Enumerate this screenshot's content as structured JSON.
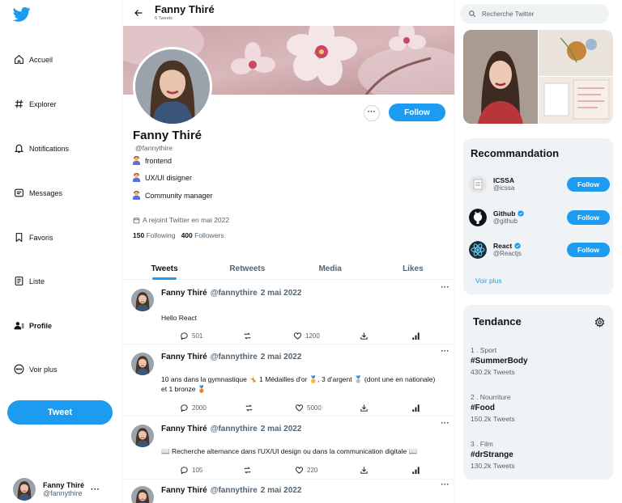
{
  "colors": {
    "accent": "#1d9bf0",
    "text": "#0f1419",
    "muted": "#536471",
    "card": "#f0f3f5"
  },
  "sidebar": {
    "logo": "twitter-bird-icon",
    "items": [
      {
        "label": "Accueil",
        "icon": "home-icon"
      },
      {
        "label": "Explorer",
        "icon": "hashtag-icon"
      },
      {
        "label": "Notifications",
        "icon": "bell-icon"
      },
      {
        "label": "Messages",
        "icon": "message-icon"
      },
      {
        "label": "Favoris",
        "icon": "bookmark-icon"
      },
      {
        "label": "Liste",
        "icon": "list-icon"
      },
      {
        "label": "Profile",
        "icon": "profile-icon"
      },
      {
        "label": "Voir plus",
        "icon": "more-circle-icon"
      }
    ],
    "tweet_button": "Tweet",
    "account": {
      "name": "Fanny Thiré",
      "handle": "@fannythire",
      "more": "···"
    }
  },
  "header": {
    "name": "Fanny Thiré",
    "tweet_count": "6 Tweets"
  },
  "profile": {
    "follow_button": "Follow",
    "more": "···",
    "name": "Fanny Thiré",
    "handle": "@fannythire",
    "bio": [
      "frontend",
      "UX/UI disigner",
      "Community manager"
    ],
    "joined": "A rejoint Twitter en mai 2022",
    "following_count": "150",
    "following_label": "Following",
    "followers_count": "400",
    "followers_label": "Followers"
  },
  "tabs": [
    "Tweets",
    "Retweets",
    "Media",
    "Likes"
  ],
  "tweets": [
    {
      "name": "Fanny Thiré",
      "handle": "@fannythire",
      "date": "2 mai 2022",
      "more": "···",
      "text": "Hello React",
      "replies": "501",
      "likes": "1200"
    },
    {
      "name": "Fanny Thiré",
      "handle": "@fannythire",
      "date": "2 mai 2022",
      "more": "···",
      "text": "10 ans dans la gymnastique 🤸 1 Médailles d'or 🥇, 3 d'argent 🥈 (dont une en nationale) et 1 bronze 🥉",
      "replies": "2000",
      "likes": "5000"
    },
    {
      "name": "Fanny Thiré",
      "handle": "@fannythire",
      "date": "2 mai 2022",
      "more": "···",
      "text": "📖 Recherche alternance dans l'UX/UI design ou dans la communication digitale 📖",
      "replies": "105",
      "likes": "220"
    },
    {
      "name": "Fanny Thiré",
      "handle": "@fannythire",
      "date": "2 mai 2022",
      "more": "···"
    }
  ],
  "search": {
    "placeholder": "Recherche Twitter"
  },
  "recommandation": {
    "title": "Recommandation",
    "accounts": [
      {
        "name": "ICSSA",
        "handle": "@icssa",
        "verified": false,
        "follow": "Follow"
      },
      {
        "name": "Github",
        "handle": "@github",
        "verified": true,
        "follow": "Follow"
      },
      {
        "name": "React",
        "handle": "@Reactjs",
        "verified": true,
        "follow": "Follow"
      }
    ],
    "see_more": "Voir plus"
  },
  "tendance": {
    "title": "Tendance",
    "trends": [
      {
        "category": "1 . Sport",
        "tag": "#SummerBody",
        "count": "430.2k Tweets"
      },
      {
        "category": "2 . Nourriture",
        "tag": "#Food",
        "count": "150.2k Tweets"
      },
      {
        "category": "3 . Film",
        "tag": "#drStrange",
        "count": "130.2k Tweets"
      }
    ]
  }
}
